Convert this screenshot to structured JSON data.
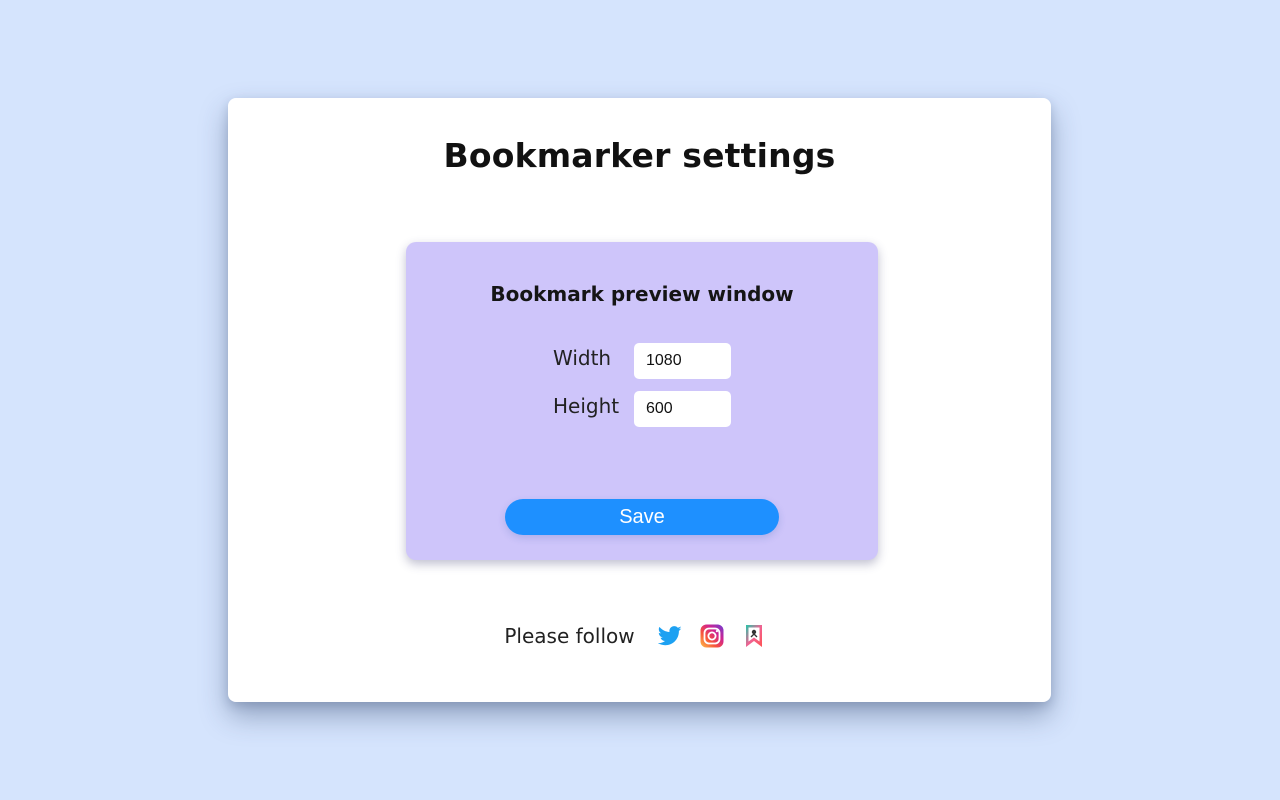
{
  "page": {
    "title": "Bookmarker settings"
  },
  "preview": {
    "title": "Bookmark preview window",
    "width_label": "Width",
    "width_value": "1080",
    "height_label": "Height",
    "height_value": "600",
    "save_label": "Save"
  },
  "footer": {
    "follow_text": "Please follow",
    "links": [
      {
        "icon": "twitter-icon"
      },
      {
        "icon": "instagram-icon"
      },
      {
        "icon": "bookmarker-icon"
      }
    ]
  },
  "colors": {
    "background": "#d5e4fd",
    "card": "#ffffff",
    "panel": "#cec5fa",
    "button": "#1e90ff",
    "twitter": "#1da1f2"
  }
}
